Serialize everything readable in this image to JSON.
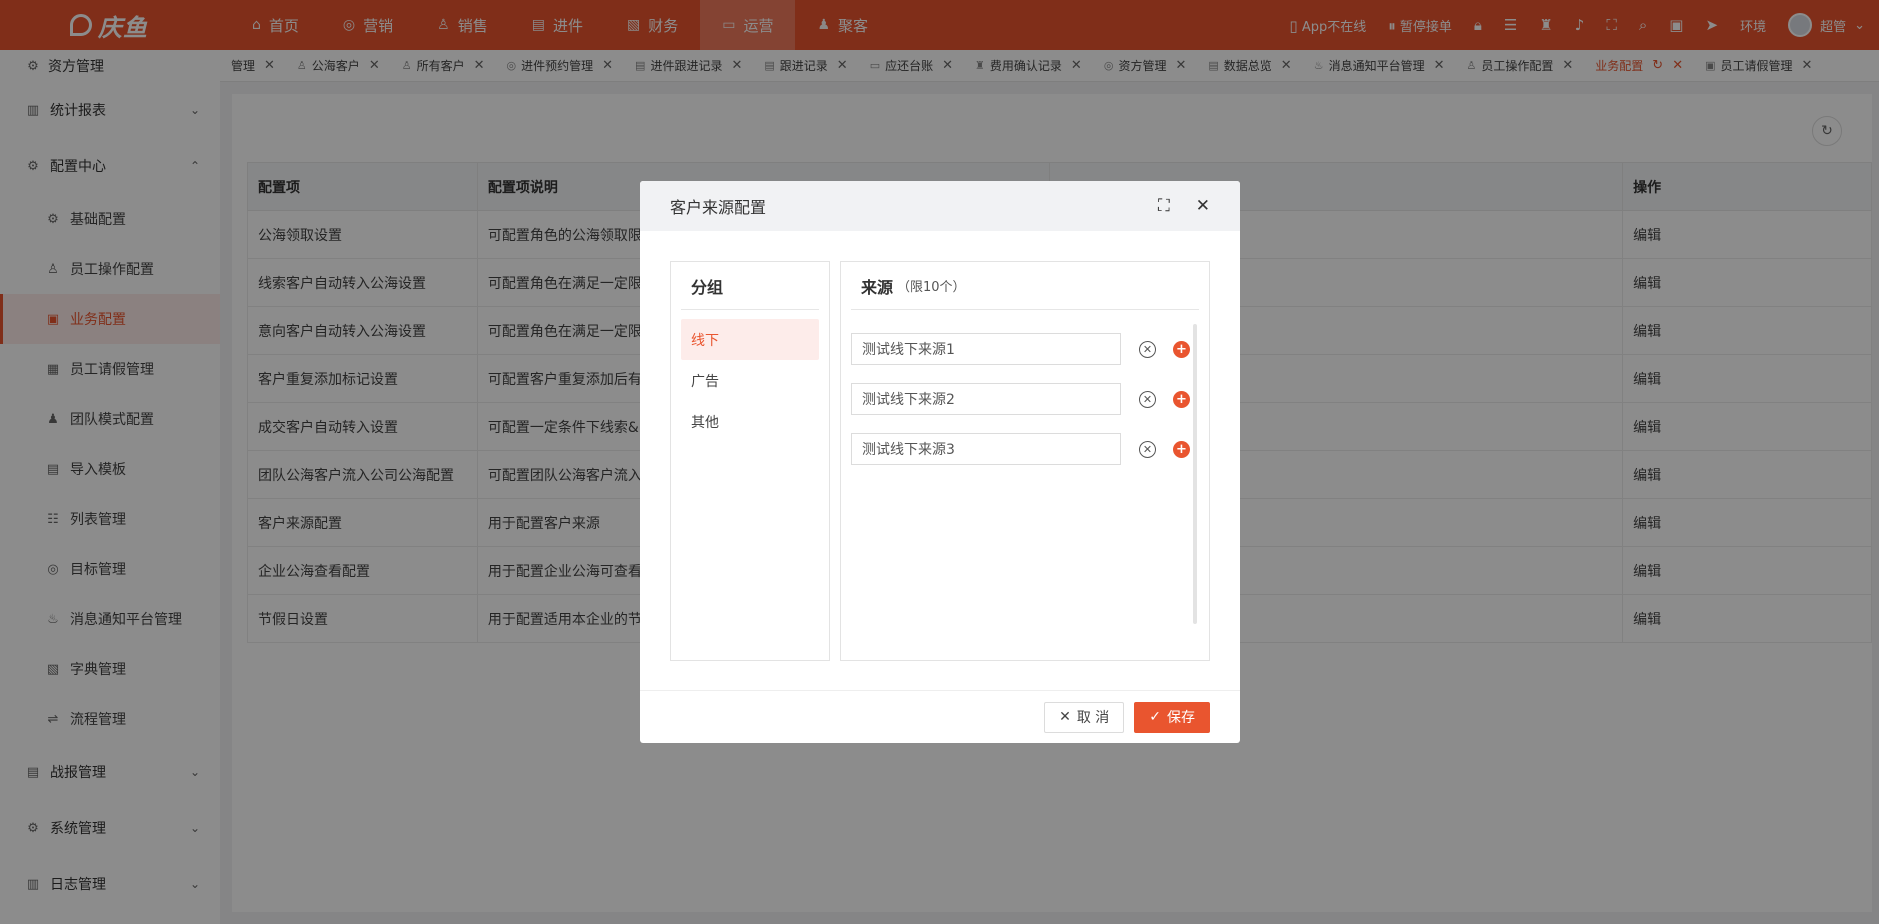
{
  "brand": {
    "name": "庆鱼",
    "color": "#e9552f"
  },
  "nav": [
    {
      "label": "首页",
      "icon": "home-icon",
      "glyph": "⌂"
    },
    {
      "label": "营销",
      "icon": "target-icon",
      "glyph": "◎"
    },
    {
      "label": "销售",
      "icon": "user-icon",
      "glyph": "♙"
    },
    {
      "label": "进件",
      "icon": "document-icon",
      "glyph": "▤"
    },
    {
      "label": "财务",
      "icon": "ledger-icon",
      "glyph": "▧"
    },
    {
      "label": "运营",
      "icon": "monitor-icon",
      "glyph": "▭"
    },
    {
      "label": "聚客",
      "icon": "people-icon",
      "glyph": "♟"
    }
  ],
  "top_right": {
    "app_status": "App不在线",
    "pause_label": "暂停接单",
    "env": "环境",
    "user": "超管"
  },
  "sidebar": {
    "top": "资方管理",
    "groups": [
      {
        "label": "统计报表",
        "icon": "chart-icon",
        "chev": "⌄"
      },
      {
        "label": "配置中心",
        "icon": "gear-icon",
        "chev": "⌃"
      }
    ],
    "items": [
      {
        "label": "基础配置",
        "icon": "gear-icon"
      },
      {
        "label": "员工操作配置",
        "icon": "user-icon"
      },
      {
        "label": "业务配置",
        "icon": "briefcase-icon"
      },
      {
        "label": "员工请假管理",
        "icon": "calendar-icon"
      },
      {
        "label": "团队模式配置",
        "icon": "team-icon"
      },
      {
        "label": "导入模板",
        "icon": "import-icon"
      },
      {
        "label": "列表管理",
        "icon": "list-icon"
      },
      {
        "label": "目标管理",
        "icon": "target-icon"
      },
      {
        "label": "消息通知平台管理",
        "icon": "bell-icon"
      },
      {
        "label": "字典管理",
        "icon": "book-icon"
      },
      {
        "label": "流程管理",
        "icon": "flow-icon"
      }
    ],
    "bottom_groups": [
      {
        "label": "战报管理",
        "icon": "report-icon"
      },
      {
        "label": "系统管理",
        "icon": "system-icon"
      },
      {
        "label": "日志管理",
        "icon": "log-icon"
      }
    ]
  },
  "tabs": [
    "管理",
    "公海客户",
    "所有客户",
    "进件预约管理",
    "进件跟进记录",
    "跟进记录",
    "应还台账",
    "费用确认记录",
    "资方管理",
    "数据总览",
    "消息通知平台管理",
    "员工操作配置",
    "业务配置",
    "员工请假管理"
  ],
  "active_tab": "业务配置",
  "table": {
    "headers": [
      "配置项",
      "配置项说明",
      "",
      "操作"
    ],
    "rows": [
      [
        "公海领取设置",
        "可配置角色的公海领取限",
        "编辑"
      ],
      [
        "线索客户自动转入公海设置",
        "可配置角色在满足一定限",
        "编辑"
      ],
      [
        "意向客户自动转入公海设置",
        "可配置角色在满足一定限",
        "编辑"
      ],
      [
        "客户重复添加标记设置",
        "可配置客户重复添加后有",
        "编辑"
      ],
      [
        "成交客户自动转入设置",
        "可配置一定条件下线索&",
        "编辑"
      ],
      [
        "团队公海客户流入公司公海配置",
        "可配置团队公海客户流入",
        "编辑"
      ],
      [
        "客户来源配置",
        "用于配置客户来源",
        "编辑"
      ],
      [
        "企业公海查看配置",
        "用于配置企业公海可查看",
        "编辑"
      ],
      [
        "节假日设置",
        "用于配置适用本企业的节",
        "编辑"
      ]
    ]
  },
  "dialog": {
    "title": "客户来源配置",
    "group_title": "分组",
    "groups": [
      "线下",
      "广告",
      "其他"
    ],
    "source_title": "来源",
    "source_limit": "（限10个）",
    "sources": [
      "测试线下来源1",
      "测试线下来源2",
      "测试线下来源3"
    ],
    "cancel_label": "取 消",
    "save_label": "保存"
  }
}
